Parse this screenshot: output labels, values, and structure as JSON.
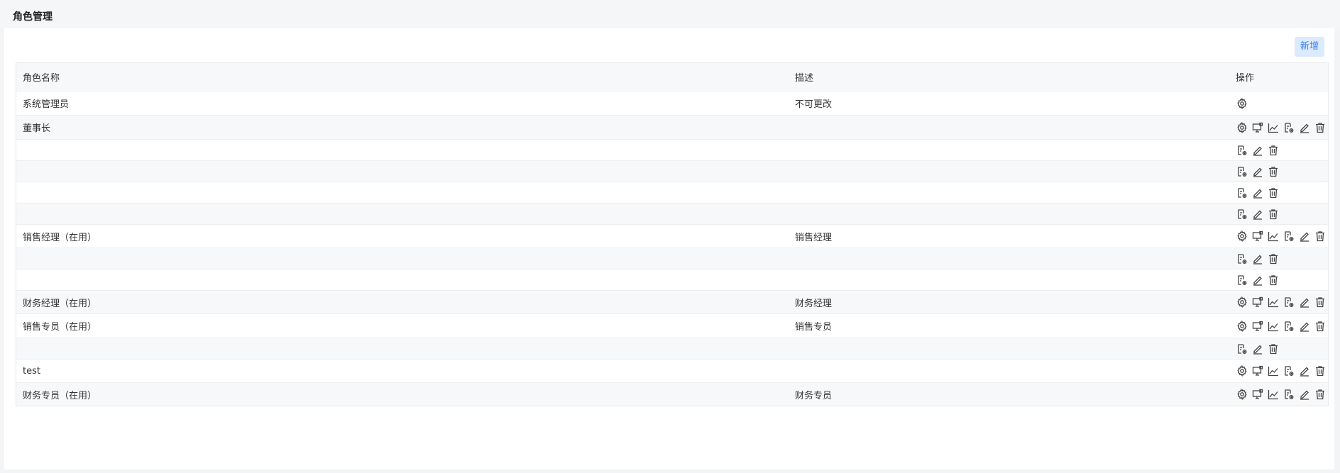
{
  "page": {
    "title": "角色管理"
  },
  "toolbar": {
    "add_label": "新增"
  },
  "table": {
    "columns": [
      "角色名称",
      "描述",
      "操作"
    ],
    "rows": [
      {
        "name": "系统管理员",
        "desc": "不可更改",
        "actions": [
          "gear-icon"
        ]
      },
      {
        "name": "董事长",
        "desc": "",
        "actions": [
          "gear-icon",
          "monitor-icon",
          "line-chart-icon",
          "doc-view-icon",
          "edit-icon",
          "delete-icon"
        ]
      },
      {
        "name": "",
        "desc": "",
        "actions": [
          "doc-view-icon",
          "edit-icon",
          "delete-icon"
        ]
      },
      {
        "name": "",
        "desc": "",
        "actions": [
          "doc-view-icon",
          "edit-icon",
          "delete-icon"
        ]
      },
      {
        "name": "",
        "desc": "",
        "actions": [
          "doc-view-icon",
          "edit-icon",
          "delete-icon"
        ]
      },
      {
        "name": "",
        "desc": "",
        "actions": [
          "doc-view-icon",
          "edit-icon",
          "delete-icon"
        ]
      },
      {
        "name": "销售经理（在用）",
        "desc": "销售经理",
        "actions": [
          "gear-icon",
          "monitor-icon",
          "line-chart-icon",
          "doc-view-icon",
          "edit-icon",
          "delete-icon"
        ]
      },
      {
        "name": "",
        "desc": "",
        "actions": [
          "doc-view-icon",
          "edit-icon",
          "delete-icon"
        ]
      },
      {
        "name": "",
        "desc": "",
        "actions": [
          "doc-view-icon",
          "edit-icon",
          "delete-icon"
        ]
      },
      {
        "name": "财务经理（在用）",
        "desc": "财务经理",
        "actions": [
          "gear-icon",
          "monitor-icon",
          "line-chart-icon",
          "doc-view-icon",
          "edit-icon",
          "delete-icon"
        ]
      },
      {
        "name": "销售专员（在用）",
        "desc": "销售专员",
        "actions": [
          "gear-icon",
          "monitor-icon",
          "line-chart-icon",
          "doc-view-icon",
          "edit-icon",
          "delete-icon"
        ]
      },
      {
        "name": "",
        "desc": "",
        "actions": [
          "doc-view-icon",
          "edit-icon",
          "delete-icon"
        ]
      },
      {
        "name": "test",
        "desc": "",
        "actions": [
          "gear-icon",
          "monitor-icon",
          "line-chart-icon",
          "doc-view-icon",
          "edit-icon",
          "delete-icon"
        ]
      },
      {
        "name": "财务专员（在用）",
        "desc": "财务专员",
        "actions": [
          "gear-icon",
          "monitor-icon",
          "line-chart-icon",
          "doc-view-icon",
          "edit-icon",
          "delete-icon"
        ]
      }
    ]
  }
}
